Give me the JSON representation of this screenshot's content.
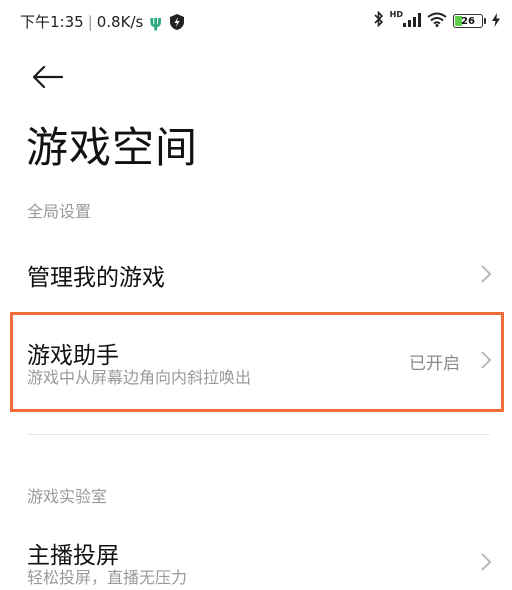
{
  "status_bar": {
    "time": "下午1:35",
    "separator": "|",
    "net_speed": "0.8K/s",
    "usb_glyph": "ψ",
    "hd_label": "HD",
    "battery_level": "26",
    "battery_fraction": 0.26,
    "icons": [
      "usb-icon",
      "shield-icon",
      "bluetooth-icon",
      "signal-icon",
      "wifi-icon",
      "battery-icon",
      "charging-icon"
    ]
  },
  "header": {
    "back_icon": "arrow-left-icon",
    "title": "游戏空间"
  },
  "sections": {
    "global": {
      "header": "全局设置",
      "manage_games": {
        "title": "管理我的游戏"
      },
      "game_assistant": {
        "title": "游戏助手",
        "subtitle": "游戏中从屏幕边角向内斜拉唤出",
        "value": "已开启"
      }
    },
    "lab": {
      "header": "游戏实验室",
      "streaming": {
        "title": "主播投屏",
        "subtitle": "轻松投屏，直播无压力"
      }
    }
  },
  "colors": {
    "highlight_border": "#f26b3a",
    "secondary_text": "#9a9a9a",
    "battery_fill": "#5fcf4a"
  }
}
